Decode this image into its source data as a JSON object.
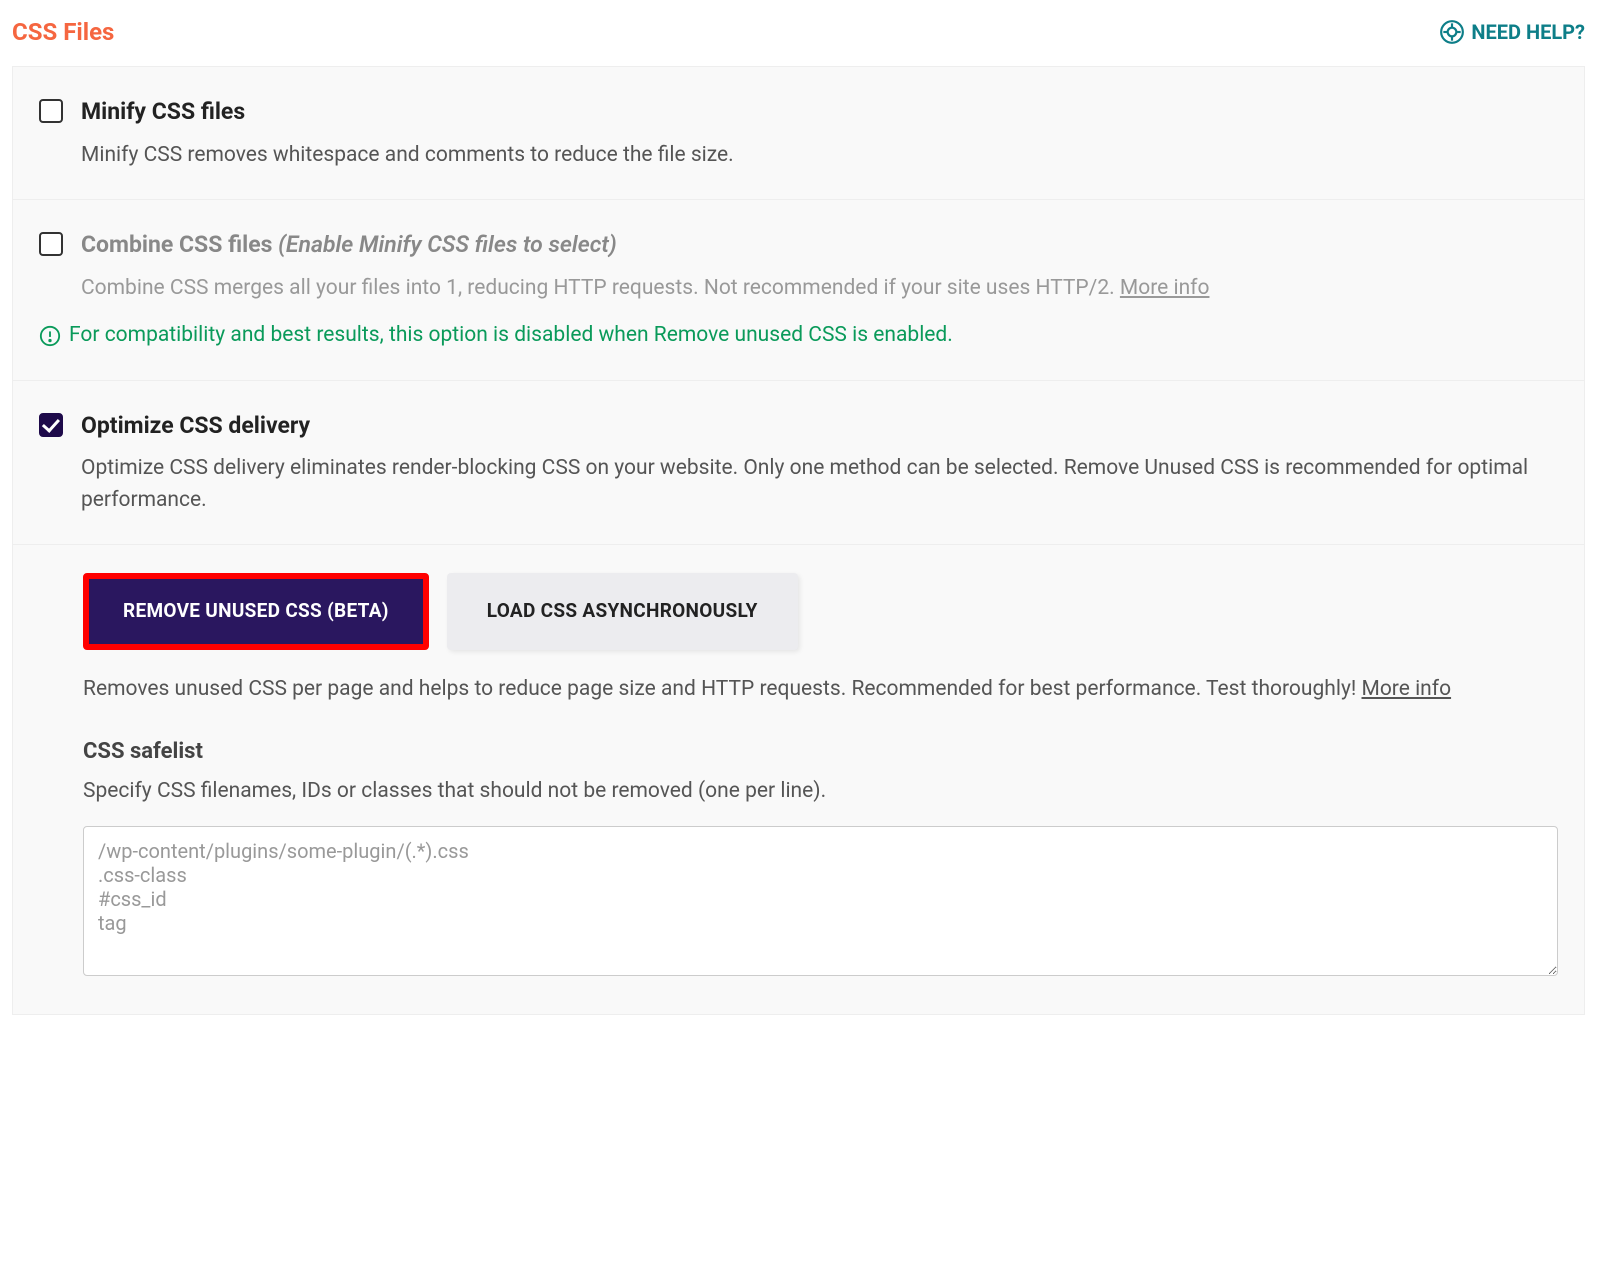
{
  "header": {
    "title": "CSS Files",
    "help_label": "NEED HELP?"
  },
  "options": {
    "minify": {
      "checked": false,
      "title": "Minify CSS files",
      "desc": "Minify CSS removes whitespace and comments to reduce the file size."
    },
    "combine": {
      "checked": false,
      "title": "Combine CSS files",
      "hint": "(Enable Minify CSS files to select)",
      "desc": "Combine CSS merges all your files into 1, reducing HTTP requests. Not recommended if your site uses HTTP/2. ",
      "more": "More info",
      "compat_note": "For compatibility and best results, this option is disabled when Remove unused CSS is enabled."
    },
    "optimize": {
      "checked": true,
      "title": "Optimize CSS delivery",
      "desc": "Optimize CSS delivery eliminates render-blocking CSS on your website. Only one method can be selected. Remove Unused CSS is recommended for optimal performance.",
      "tabs": {
        "remove": "REMOVE UNUSED CSS (BETA)",
        "async": "LOAD CSS ASYNCHRONOUSLY"
      },
      "tab_desc": "Removes unused CSS per page and helps to reduce page size and HTTP requests. Recommended for best performance. Test thoroughly! ",
      "tab_more": "More info",
      "safelist": {
        "title": "CSS safelist",
        "desc": "Specify CSS filenames, IDs or classes that should not be removed (one per line).",
        "placeholder": "/wp-content/plugins/some-plugin/(.*).css\n.css-class\n#css_id\ntag"
      }
    }
  }
}
